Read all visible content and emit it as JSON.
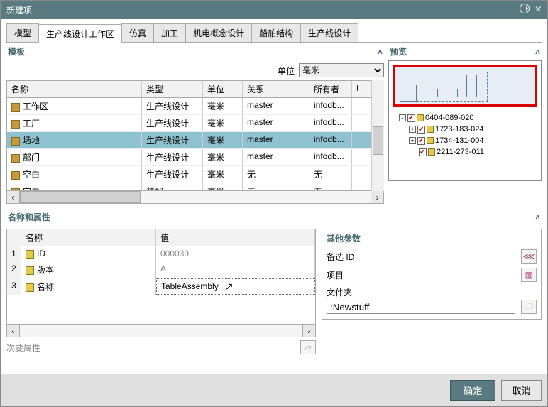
{
  "title": "新建项",
  "tabs": [
    "模型",
    "生产线设计工作区",
    "仿真",
    "加工",
    "机电概念设计",
    "船舶结构",
    "生产线设计"
  ],
  "active_tab": 1,
  "template": {
    "label": "模板",
    "unit_label": "单位",
    "unit_value": "毫米",
    "columns": [
      "名称",
      "类型",
      "单位",
      "关系",
      "所有者",
      "I"
    ],
    "rows": [
      {
        "name": "工作区",
        "type": "生产线设计",
        "unit": "毫米",
        "rel": "master",
        "owner": "infodb..."
      },
      {
        "name": "工厂",
        "type": "生产线设计",
        "unit": "毫米",
        "rel": "master",
        "owner": "infodb..."
      },
      {
        "name": "场地",
        "type": "生产线设计",
        "unit": "毫米",
        "rel": "master",
        "owner": "infodb...",
        "selected": true
      },
      {
        "name": "部门",
        "type": "生产线设计",
        "unit": "毫米",
        "rel": "master",
        "owner": "infodb..."
      },
      {
        "name": "空白",
        "type": "生产线设计",
        "unit": "毫米",
        "rel": "无",
        "owner": "无"
      },
      {
        "name": "空白",
        "type": "装配",
        "unit": "毫米",
        "rel": "无",
        "owner": "无"
      }
    ]
  },
  "preview": {
    "label": "预览",
    "tree": [
      {
        "level": 0,
        "expand": "-",
        "checked": true,
        "label": "0404-089-020"
      },
      {
        "level": 1,
        "expand": "+",
        "checked": true,
        "label": "1723-183-024"
      },
      {
        "level": 1,
        "expand": "+",
        "checked": true,
        "label": "1734-131-004"
      },
      {
        "level": 1,
        "expand": "",
        "checked": true,
        "label": "2211-273-011"
      }
    ]
  },
  "props": {
    "label": "名称和属性",
    "columns": [
      "名称",
      "值"
    ],
    "rows": [
      {
        "idx": "1",
        "name": "ID",
        "value": "000039"
      },
      {
        "idx": "2",
        "name": "版本",
        "value": "A"
      },
      {
        "idx": "3",
        "name": "名称",
        "value": "TableAssembly",
        "editing": true
      }
    ],
    "secondary_label": "次要属性"
  },
  "other": {
    "label": "其他参数",
    "alt_id_label": "备选 ID",
    "project_label": "项目",
    "folder_label": "文件夹",
    "folder_value": ":Newstuff"
  },
  "buttons": {
    "ok": "确定",
    "cancel": "取消"
  }
}
